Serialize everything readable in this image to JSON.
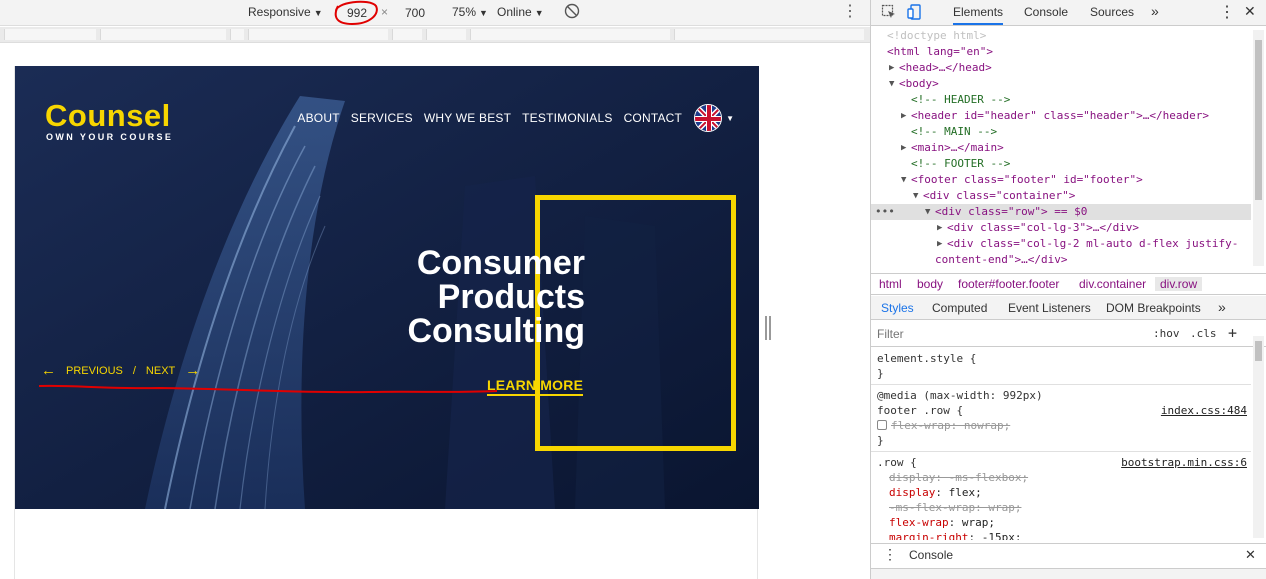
{
  "device_toolbar": {
    "mode": "Responsive",
    "width": "992",
    "height": "700",
    "times": "×",
    "zoom": "75%",
    "network": "Online"
  },
  "site": {
    "logo": "Counsel",
    "tagline": "OWN YOUR COURSE",
    "nav": [
      "ABOUT",
      "SERVICES",
      "WHY WE BEST",
      "TESTIMONIALS",
      "CONTACT"
    ],
    "headline": [
      "Consumer",
      "Products",
      "Consulting"
    ],
    "cta": "LEARN MORE",
    "slider_prev": "PREVIOUS",
    "slider_sep": "/",
    "slider_next": "NEXT",
    "accent": "#f7d600",
    "hero_bg": "#0f1d3d"
  },
  "devtools": {
    "tabs": [
      "Elements",
      "Console",
      "Sources"
    ],
    "more": "»",
    "dom": [
      "<!doctype html>",
      "<html lang=\"en\">",
      "<head>…</head>",
      "<body>",
      "<!-- HEADER -->",
      "<header id=\"header\" class=\"header\">…</header>",
      "<!-- MAIN -->",
      "<main>…</main>",
      "<!-- FOOTER -->",
      "<footer class=\"footer\" id=\"footer\">",
      "<div class=\"container\">",
      "<div class=\"row\"> == $0",
      "<div class=\"col-lg-3\">…</div>",
      "<div class=\"col-lg-2 ml-auto d-flex justify-",
      "content-end\">…</div>"
    ],
    "breadcrumbs": [
      "html",
      "body",
      "footer#footer.footer",
      "div.container",
      "div.row"
    ],
    "subtabs": [
      "Styles",
      "Computed",
      "Event Listeners",
      "DOM Breakpoints"
    ],
    "filter_placeholder": "Filter",
    "hov": ":hov",
    "cls": ".cls",
    "plus": "+",
    "styles": {
      "element_style": "element.style {",
      "close": "}",
      "media": "@media (max-width: 992px)",
      "footer_row": "footer .row {",
      "index_src": "index.css:484",
      "flex_wrap_nowrap": "flex-wrap: nowrap;",
      "row_sel": ".row {",
      "bootstrap_src": "bootstrap.min.css:6",
      "decl1": "display: -ms-flexbox;",
      "decl2_prop": "display",
      "decl2_val": "flex;",
      "decl3": "-ms-flex-wrap: wrap;",
      "decl4_prop": "flex-wrap",
      "decl4_val": "wrap;",
      "decl5_prop": "margin-right",
      "decl5_val": "-15px;"
    },
    "drawer_title": "Console"
  }
}
